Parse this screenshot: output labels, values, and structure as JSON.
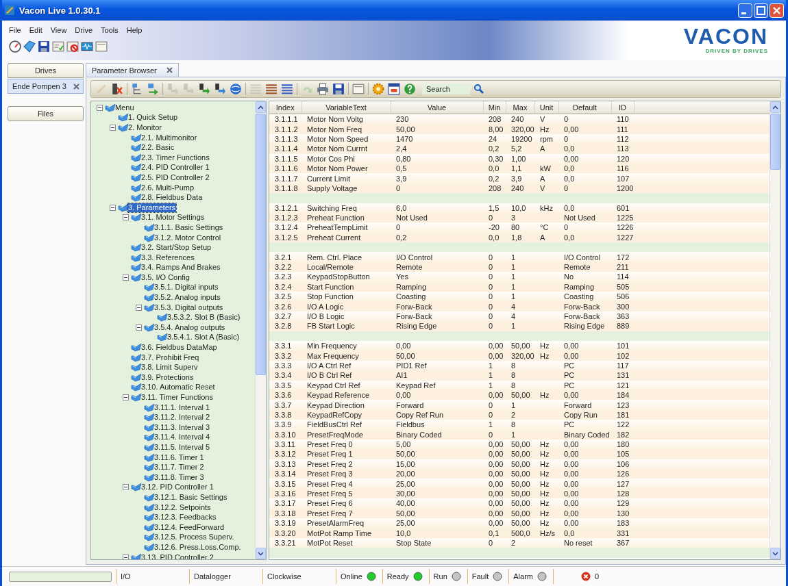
{
  "window": {
    "title": "Vacon Live 1.0.30.1"
  },
  "menu": [
    "File",
    "Edit",
    "View",
    "Drive",
    "Tools",
    "Help"
  ],
  "main_toolbar": [
    {
      "kind": "gauge"
    },
    {
      "kind": "tag"
    },
    {
      "kind": "save"
    },
    {
      "kind": "checklist"
    },
    {
      "kind": "prohibited"
    },
    {
      "kind": "monitor"
    },
    {
      "kind": "window"
    }
  ],
  "logo": {
    "name": "VACON",
    "tagline": "DRIVEN BY DRIVES"
  },
  "side": {
    "drives_button": "Drives",
    "drives": [
      {
        "label": "Ende Pompen 3",
        "selected": true
      }
    ],
    "files_button": "Files"
  },
  "tabs": [
    {
      "label": "Parameter Browser",
      "selected": true
    }
  ],
  "toolbar": [
    {
      "kind": "pencil",
      "disabled": true
    },
    {
      "kind": "delete",
      "disabled": false
    },
    {
      "kind": "tree",
      "disabled": false
    },
    {
      "kind": "export",
      "disabled": false
    },
    {
      "kind": "step",
      "disabled": true
    },
    {
      "kind": "step",
      "disabled": true
    },
    {
      "kind": "step",
      "disabled": false,
      "color": "#2f9e2f"
    },
    {
      "kind": "step",
      "disabled": false,
      "color": "#2d7fd0"
    },
    {
      "kind": "globe",
      "disabled": false
    },
    {
      "kind": "list",
      "disabled": true
    },
    {
      "kind": "list",
      "disabled": false,
      "color": "#a0522d"
    },
    {
      "kind": "list",
      "disabled": false,
      "color": "#3a5fcd"
    },
    {
      "kind": "undo",
      "disabled": true
    },
    {
      "kind": "print",
      "disabled": false
    },
    {
      "kind": "save",
      "disabled": false
    },
    {
      "kind": "window",
      "disabled": false
    },
    {
      "kind": "gear",
      "disabled": false
    },
    {
      "kind": "calendar",
      "disabled": false
    },
    {
      "kind": "help",
      "disabled": false
    }
  ],
  "search": {
    "placeholder": "Search"
  },
  "tree": [
    {
      "label": "Menu",
      "expanded": true,
      "selected": false,
      "children": [
        {
          "label": "1. Quick Setup",
          "selected": false
        },
        {
          "label": "2. Monitor",
          "expanded": true,
          "selected": false,
          "children": [
            {
              "label": "2.1. Multimonitor",
              "selected": false
            },
            {
              "label": "2.2. Basic",
              "selected": false
            },
            {
              "label": "2.3. Timer Functions",
              "selected": false
            },
            {
              "label": "2.4. PID Controller 1",
              "selected": false
            },
            {
              "label": "2.5. PID Controller 2",
              "selected": false
            },
            {
              "label": "2.6. Multi-Pump",
              "selected": false
            },
            {
              "label": "2.8. Fieldbus Data",
              "selected": false
            }
          ]
        },
        {
          "label": "3. Parameters",
          "expanded": true,
          "selected": true,
          "children": [
            {
              "label": "3.1. Motor Settings",
              "expanded": true,
              "selected": false,
              "children": [
                {
                  "label": "3.1.1. Basic Settings",
                  "selected": false
                },
                {
                  "label": "3.1.2. Motor Control",
                  "selected": false
                }
              ]
            },
            {
              "label": "3.2. Start/Stop Setup",
              "selected": false
            },
            {
              "label": "3.3. References",
              "selected": false
            },
            {
              "label": "3.4. Ramps And Brakes",
              "selected": false
            },
            {
              "label": "3.5. I/O Config",
              "expanded": true,
              "selected": false,
              "children": [
                {
                  "label": "3.5.1. Digital inputs",
                  "selected": false
                },
                {
                  "label": "3.5.2. Analog inputs",
                  "selected": false
                },
                {
                  "label": "3.5.3. Digital outputs",
                  "expanded": true,
                  "selected": false,
                  "children": [
                    {
                      "label": "3.5.3.2. Slot B (Basic)",
                      "selected": false
                    }
                  ]
                },
                {
                  "label": "3.5.4. Analog outputs",
                  "expanded": true,
                  "selected": false,
                  "children": [
                    {
                      "label": "3.5.4.1. Slot A (Basic)",
                      "selected": false
                    }
                  ]
                }
              ]
            },
            {
              "label": "3.6. Fieldbus DataMap",
              "selected": false
            },
            {
              "label": "3.7. Prohibit Freq",
              "selected": false
            },
            {
              "label": "3.8. Limit Superv",
              "selected": false
            },
            {
              "label": "3.9. Protections",
              "selected": false
            },
            {
              "label": "3.10. Automatic Reset",
              "selected": false
            },
            {
              "label": "3.11. Timer Functions",
              "expanded": true,
              "selected": false,
              "children": [
                {
                  "label": "3.11.1. Interval 1",
                  "selected": false
                },
                {
                  "label": "3.11.2. Interval 2",
                  "selected": false
                },
                {
                  "label": "3.11.3. Interval 3",
                  "selected": false
                },
                {
                  "label": "3.11.4. Interval 4",
                  "selected": false
                },
                {
                  "label": "3.11.5. Interval 5",
                  "selected": false
                },
                {
                  "label": "3.11.6. Timer 1",
                  "selected": false
                },
                {
                  "label": "3.11.7. Timer 2",
                  "selected": false
                },
                {
                  "label": "3.11.8. Timer 3",
                  "selected": false
                }
              ]
            },
            {
              "label": "3.12. PID Controller 1",
              "expanded": true,
              "selected": false,
              "children": [
                {
                  "label": "3.12.1. Basic Settings",
                  "selected": false
                },
                {
                  "label": "3.12.2. Setpoints",
                  "selected": false
                },
                {
                  "label": "3.12.3. Feedbacks",
                  "selected": false
                },
                {
                  "label": "3.12.4. FeedForward",
                  "selected": false
                },
                {
                  "label": "3.12.5. Process Superv.",
                  "selected": false
                },
                {
                  "label": "3.12.6. Press.Loss.Comp.",
                  "selected": false
                }
              ]
            },
            {
              "label": "3.13. PID Controller 2",
              "expanded": true,
              "selected": false
            }
          ]
        }
      ]
    }
  ],
  "table": {
    "columns": [
      "Index",
      "VariableText",
      "Value",
      "Min",
      "Max",
      "Unit",
      "Default",
      "ID"
    ],
    "groups": [
      {
        "rows": [
          [
            "3.1.1.1",
            "Motor Nom Voltg",
            "230",
            "208",
            "240",
            "V",
            "0",
            "110"
          ],
          [
            "3.1.1.2",
            "Motor Nom Freq",
            "50,00",
            "8,00",
            "320,00",
            "Hz",
            "0,00",
            "111"
          ],
          [
            "3.1.1.3",
            "Motor Nom Speed",
            "1470",
            "24",
            "19200",
            "rpm",
            "0",
            "112"
          ],
          [
            "3.1.1.4",
            "Motor Nom Currnt",
            "2,4",
            "0,2",
            "5,2",
            "A",
            "0,0",
            "113"
          ],
          [
            "3.1.1.5",
            "Motor Cos Phi",
            "0,80",
            "0,30",
            "1,00",
            "",
            "0,00",
            "120"
          ],
          [
            "3.1.1.6",
            "Motor Nom Power",
            "0,5",
            "0,0",
            "1,1",
            "kW",
            "0,0",
            "116"
          ],
          [
            "3.1.1.7",
            "Current Limit",
            "3,9",
            "0,2",
            "3,9",
            "A",
            "0,0",
            "107"
          ],
          [
            "3.1.1.8",
            "Supply Voltage",
            "0",
            "208",
            "240",
            "V",
            "0",
            "1200"
          ]
        ]
      },
      {
        "rows": [
          [
            "3.1.2.1",
            "Switching Freq",
            "6,0",
            "1,5",
            "10,0",
            "kHz",
            "0,0",
            "601"
          ],
          [
            "3.1.2.3",
            "Preheat Function",
            "Not Used",
            "0",
            "3",
            "",
            "Not Used",
            "1225"
          ],
          [
            "3.1.2.4",
            "PreheatTempLimit",
            "0",
            "-20",
            "80",
            "°C",
            "0",
            "1226"
          ],
          [
            "3.1.2.5",
            "Preheat Current",
            "0,2",
            "0,0",
            "1,8",
            "A",
            "0,0",
            "1227"
          ]
        ]
      },
      {
        "rows": [
          [
            "3.2.1",
            "Rem. Ctrl. Place",
            "I/O Control",
            "0",
            "1",
            "",
            "I/O Control",
            "172"
          ],
          [
            "3.2.2",
            "Local/Remote",
            "Remote",
            "0",
            "1",
            "",
            "Remote",
            "211"
          ],
          [
            "3.2.3",
            "KeypadStopButton",
            "Yes",
            "0",
            "1",
            "",
            "No",
            "114"
          ],
          [
            "3.2.4",
            "Start Function",
            "Ramping",
            "0",
            "1",
            "",
            "Ramping",
            "505"
          ],
          [
            "3.2.5",
            "Stop Function",
            "Coasting",
            "0",
            "1",
            "",
            "Coasting",
            "506"
          ],
          [
            "3.2.6",
            "I/O A Logic",
            "Forw-Back",
            "0",
            "4",
            "",
            "Forw-Back",
            "300"
          ],
          [
            "3.2.7",
            "I/O B Logic",
            "Forw-Back",
            "0",
            "4",
            "",
            "Forw-Back",
            "363"
          ],
          [
            "3.2.8",
            "FB Start Logic",
            "Rising Edge",
            "0",
            "1",
            "",
            "Rising Edge",
            "889"
          ]
        ]
      },
      {
        "rows": [
          [
            "3.3.1",
            "Min Frequency",
            "0,00",
            "0,00",
            "50,00",
            "Hz",
            "0,00",
            "101"
          ],
          [
            "3.3.2",
            "Max Frequency",
            "50,00",
            "0,00",
            "320,00",
            "Hz",
            "0,00",
            "102"
          ],
          [
            "3.3.3",
            "I/O A Ctrl Ref",
            "PID1 Ref",
            "1",
            "8",
            "",
            "PC",
            "117"
          ],
          [
            "3.3.4",
            "I/O B Ctrl Ref",
            "AI1",
            "1",
            "8",
            "",
            "PC",
            "131"
          ],
          [
            "3.3.5",
            "Keypad Ctrl Ref",
            "Keypad Ref",
            "1",
            "8",
            "",
            "PC",
            "121"
          ],
          [
            "3.3.6",
            "Keypad Reference",
            "0,00",
            "0,00",
            "50,00",
            "Hz",
            "0,00",
            "184"
          ],
          [
            "3.3.7",
            "Keypad Direction",
            "Forward",
            "0",
            "1",
            "",
            "Forward",
            "123"
          ],
          [
            "3.3.8",
            "KeypadRefCopy",
            "Copy Ref Run",
            "0",
            "2",
            "",
            "Copy Run",
            "181"
          ],
          [
            "3.3.9",
            "FieldBusCtrl Ref",
            "Fieldbus",
            "1",
            "8",
            "",
            "PC",
            "122"
          ],
          [
            "3.3.10",
            "PresetFreqMode",
            "Binary Coded",
            "0",
            "1",
            "",
            "Binary Coded",
            "182"
          ],
          [
            "3.3.11",
            "Preset Freq 0",
            "5,00",
            "0,00",
            "50,00",
            "Hz",
            "0,00",
            "180"
          ],
          [
            "3.3.12",
            "Preset Freq 1",
            "50,00",
            "0,00",
            "50,00",
            "Hz",
            "0,00",
            "105"
          ],
          [
            "3.3.13",
            "Preset Freq 2",
            "15,00",
            "0,00",
            "50,00",
            "Hz",
            "0,00",
            "106"
          ],
          [
            "3.3.14",
            "Preset Freq 3",
            "20,00",
            "0,00",
            "50,00",
            "Hz",
            "0,00",
            "126"
          ],
          [
            "3.3.15",
            "Preset Freq 4",
            "25,00",
            "0,00",
            "50,00",
            "Hz",
            "0,00",
            "127"
          ],
          [
            "3.3.16",
            "Preset Freq 5",
            "30,00",
            "0,00",
            "50,00",
            "Hz",
            "0,00",
            "128"
          ],
          [
            "3.3.17",
            "Preset Freq 6",
            "40,00",
            "0,00",
            "50,00",
            "Hz",
            "0,00",
            "129"
          ],
          [
            "3.3.18",
            "Preset Freq 7",
            "50,00",
            "0,00",
            "50,00",
            "Hz",
            "0,00",
            "130"
          ],
          [
            "3.3.19",
            "PresetAlarmFreq",
            "25,00",
            "0,00",
            "50,00",
            "Hz",
            "0,00",
            "183"
          ],
          [
            "3.3.20",
            "MotPot Ramp Time",
            "10,0",
            "0,1",
            "500,0",
            "Hz/s",
            "0,0",
            "331"
          ],
          [
            "3.3.21",
            "MotPot Reset",
            "Stop State",
            "0",
            "2",
            "",
            "No reset",
            "367"
          ]
        ]
      }
    ]
  },
  "status_bar": {
    "segments": [
      "I/O",
      "Datalogger",
      "Clockwise"
    ],
    "lights": [
      {
        "label": "Online",
        "on": true
      },
      {
        "label": "Ready",
        "on": true
      },
      {
        "label": "Run",
        "on": false
      },
      {
        "label": "Fault",
        "on": false
      },
      {
        "label": "Alarm",
        "on": false
      }
    ],
    "errors": "0"
  }
}
